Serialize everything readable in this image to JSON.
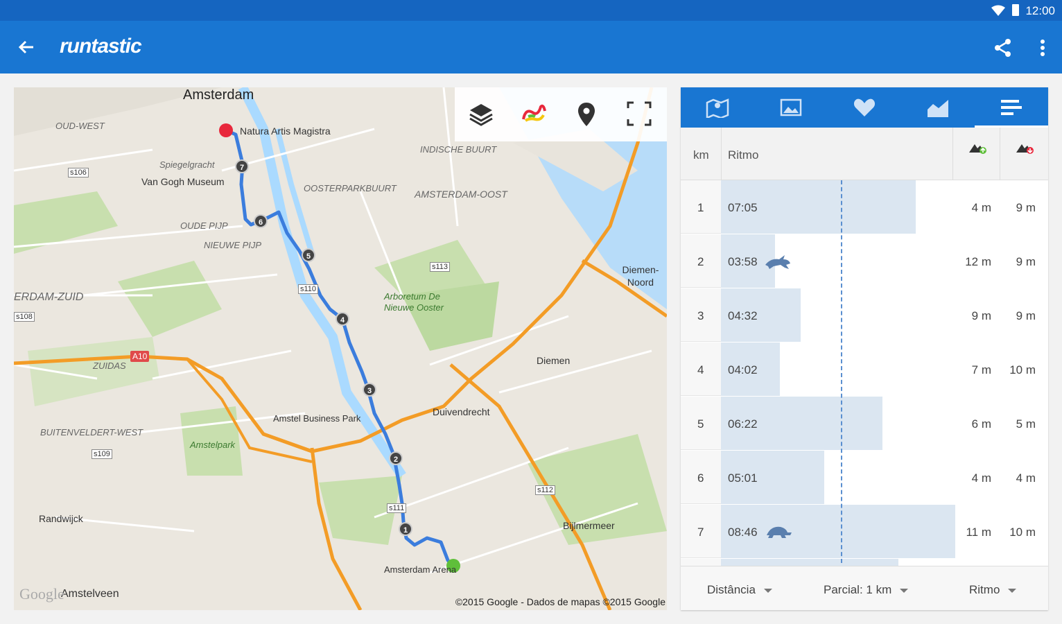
{
  "status_bar": {
    "time": "12:00",
    "wifi_icon": "wifi-icon",
    "battery_icon": "battery-icon"
  },
  "app_bar": {
    "title": "runtastic",
    "back_icon": "arrow-back-icon",
    "share_icon": "share-icon",
    "more_icon": "more-vert-icon"
  },
  "map": {
    "tools": [
      "layers-icon",
      "route-color-icon",
      "location-pin-icon",
      "fullscreen-icon"
    ],
    "labels": {
      "amsterdam": "Amsterdam",
      "natura": "Natura Artis Magistra",
      "oud_west": "OUD-WEST",
      "spiegelgracht": "Spiegelgracht",
      "van_gogh": "Van Gogh Museum",
      "oude_pijp": "OUDE PIJP",
      "nieuwe_pijp": "NIEUWE PIJP",
      "indische": "INDISCHE BUURT",
      "oosterpark": "OOSTERPARKBUURT",
      "amsterdam_oost": "AMSTERDAM-OOST",
      "arboretum": "Arboretum De Nieuwe Ooster",
      "diemen_noord": "Diemen-Noord",
      "erdam_zuid": "ERDAM-ZUID",
      "zuidas": "ZUIDAS",
      "a10": "A10",
      "diemen": "Diemen",
      "duivendrecht": "Duivendrecht",
      "amstel_business": "Amstel Business Park",
      "buitenveldert": "BUITENVELDERT-WEST",
      "amstelpark": "Amstelpark",
      "randwijck": "Randwijck",
      "bijlmermeer": "Bijlmermeer",
      "amsterdam_arena": "Amsterdam Arena",
      "amstelveen": "Amstelveen",
      "s106": "s106",
      "s108": "s108",
      "s109": "s109",
      "s110": "s110",
      "s111": "s111",
      "s112": "s112",
      "s113": "s113"
    },
    "markers": [
      "1",
      "2",
      "3",
      "4",
      "5",
      "6",
      "7"
    ],
    "google": "Google",
    "copyright": "©2015 Google - Dados de mapas ©2015 Google",
    "colors": {
      "route": "#3b7ddd",
      "highway": "#f39c26",
      "start": "#5fbf3a",
      "end": "#e8283c"
    }
  },
  "panel": {
    "tabs": [
      "map-icon",
      "image-icon",
      "heart-icon",
      "chart-icon",
      "splits-icon"
    ],
    "active_tab": 4,
    "header": {
      "km": "km",
      "ritmo": "Ritmo",
      "elev_up_icon": "elevation-gain-icon",
      "elev_down_icon": "elevation-loss-icon"
    },
    "rows": [
      {
        "km": "1",
        "pace": "07:05",
        "up": "4 m",
        "down": "9 m",
        "bar": 0.83,
        "animal": ""
      },
      {
        "km": "2",
        "pace": "03:58",
        "up": "12 m",
        "down": "9 m",
        "bar": 0.23,
        "animal": "rabbit-icon"
      },
      {
        "km": "3",
        "pace": "04:32",
        "up": "9 m",
        "down": "9 m",
        "bar": 0.34,
        "animal": ""
      },
      {
        "km": "4",
        "pace": "04:02",
        "up": "7 m",
        "down": "10 m",
        "bar": 0.25,
        "animal": ""
      },
      {
        "km": "5",
        "pace": "06:22",
        "up": "6 m",
        "down": "5 m",
        "bar": 0.69,
        "animal": ""
      },
      {
        "km": "6",
        "pace": "05:01",
        "up": "4 m",
        "down": "4 m",
        "bar": 0.44,
        "animal": ""
      },
      {
        "km": "7",
        "pace": "08:46",
        "up": "11 m",
        "down": "10 m",
        "bar": 1.0,
        "animal": "turtle-icon"
      }
    ],
    "footer": {
      "distancia": "Distância",
      "parcial": "Parcial: 1 km",
      "ritmo": "Ritmo"
    }
  }
}
